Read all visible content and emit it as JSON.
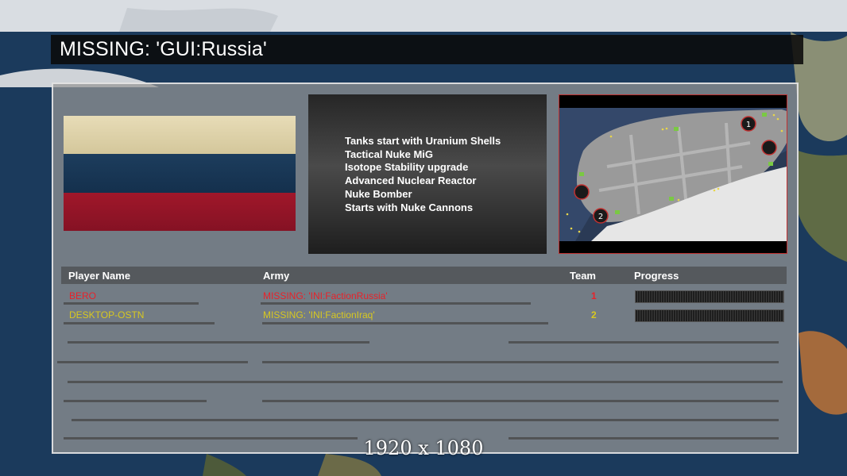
{
  "title": "MISSING: 'GUI:Russia'",
  "faction_traits": [
    "Tanks start with Uranium Shells",
    "Tactical Nuke MiG",
    "Isotope Stability upgrade",
    "Advanced Nuclear Reactor",
    "Nuke Bomber",
    "Starts with Nuke Cannons"
  ],
  "flag": {
    "colors": [
      "#e2d6ad",
      "#1a3858",
      "#991628"
    ]
  },
  "minimap": {
    "start_markers": [
      "1",
      "2"
    ]
  },
  "players_table": {
    "headers": {
      "name": "Player Name",
      "army": "Army",
      "team": "Team",
      "progress": "Progress"
    },
    "rows": [
      {
        "name": "BERO",
        "army": "MISSING: 'INI:FactionRussia'",
        "team": "1",
        "color": "#e8222a"
      },
      {
        "name": "DESKTOP-OSTN",
        "army": "MISSING: 'INI:FactionIraq'",
        "team": "2",
        "color": "#d8c820"
      }
    ]
  },
  "resolution_label": "1920 x 1080"
}
